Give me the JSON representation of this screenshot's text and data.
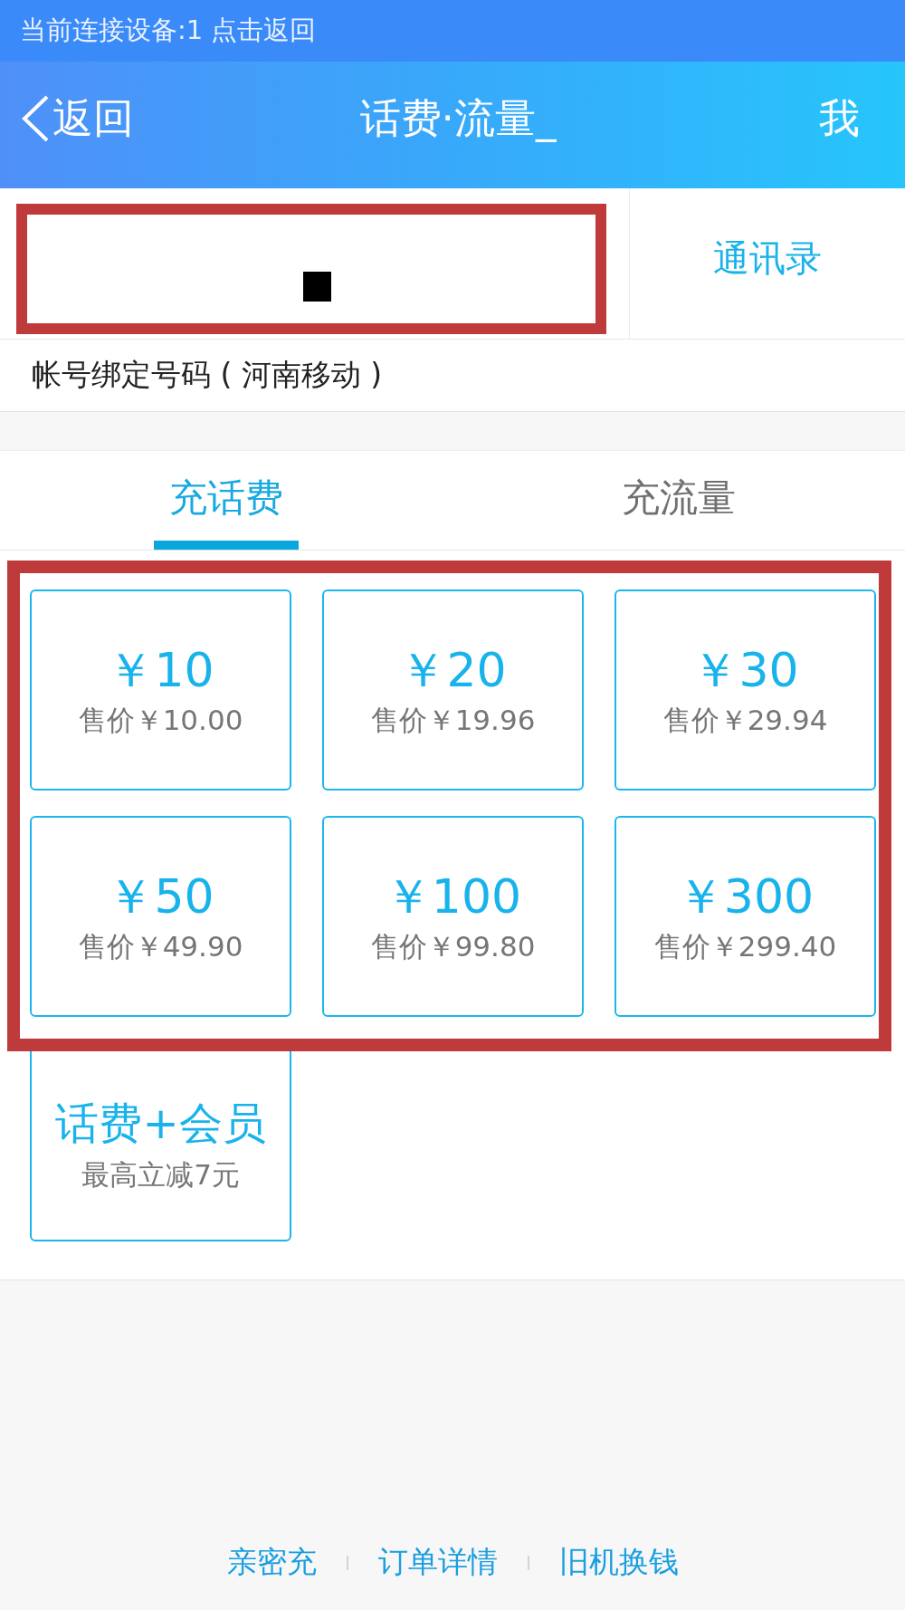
{
  "status_bar": {
    "text": "当前连接设备:1 点击返回"
  },
  "header": {
    "back_label": "返回",
    "title": "话费·流量_",
    "profile_label": "我"
  },
  "phone_field": {
    "highlighted": true
  },
  "contacts_button": {
    "label": "通讯录"
  },
  "account_note": "帐号绑定号码 ( 河南移动 )",
  "tabs": [
    {
      "label": "充话费",
      "selected": true
    },
    {
      "label": "充流量",
      "selected": false
    }
  ],
  "options": {
    "highlighted": true,
    "items": [
      {
        "face_value": "￥10",
        "price": "售价￥10.00"
      },
      {
        "face_value": "￥20",
        "price": "售价￥19.96"
      },
      {
        "face_value": "￥30",
        "price": "售价￥29.94"
      },
      {
        "face_value": "￥50",
        "price": "售价￥49.90"
      },
      {
        "face_value": "￥100",
        "price": "售价￥99.80"
      },
      {
        "face_value": "￥300",
        "price": "售价￥299.40"
      }
    ]
  },
  "bundle_option": {
    "title": "话费+会员",
    "subtitle": "最高立减7元"
  },
  "footer_links": [
    "亲密充",
    "订单详情",
    "旧机换钱"
  ]
}
